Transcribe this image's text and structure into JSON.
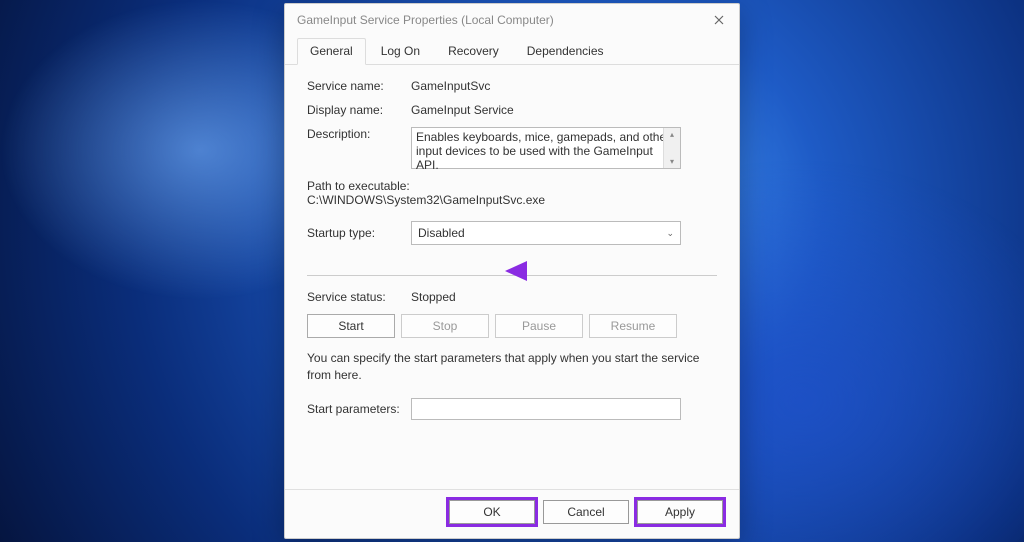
{
  "dialog": {
    "title": "GameInput Service Properties (Local Computer)"
  },
  "tabs": {
    "general": "General",
    "logon": "Log On",
    "recovery": "Recovery",
    "dependencies": "Dependencies"
  },
  "fields": {
    "service_name_label": "Service name:",
    "service_name_value": "GameInputSvc",
    "display_name_label": "Display name:",
    "display_name_value": "GameInput Service",
    "description_label": "Description:",
    "description_value": "Enables keyboards, mice, gamepads, and other input devices to be used with the GameInput API.",
    "path_label": "Path to executable:",
    "path_value": "C:\\WINDOWS\\System32\\GameInputSvc.exe",
    "startup_type_label": "Startup type:",
    "startup_type_value": "Disabled",
    "service_status_label": "Service status:",
    "service_status_value": "Stopped",
    "hint": "You can specify the start parameters that apply when you start the service from here.",
    "start_params_label": "Start parameters:"
  },
  "buttons": {
    "start": "Start",
    "stop": "Stop",
    "pause": "Pause",
    "resume": "Resume",
    "ok": "OK",
    "cancel": "Cancel",
    "apply": "Apply"
  }
}
